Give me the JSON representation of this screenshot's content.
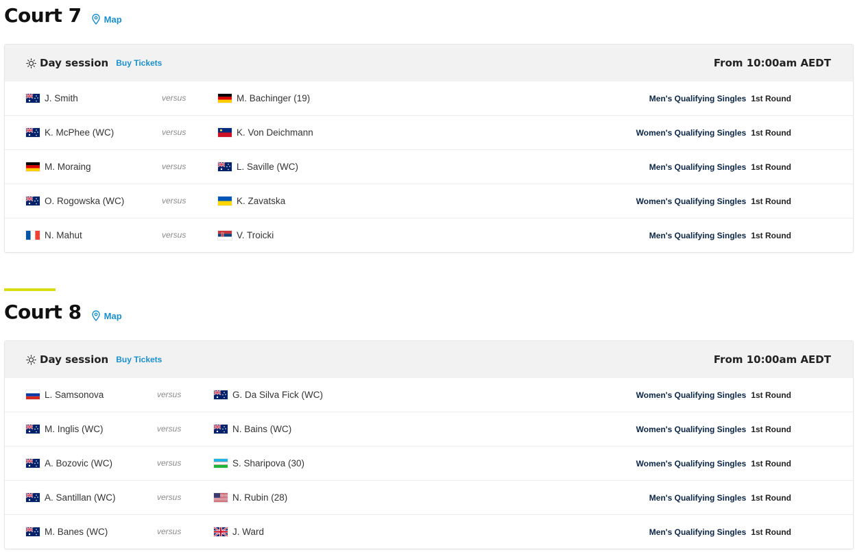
{
  "courts": [
    {
      "title": "Court 7",
      "map_label": "Map",
      "session": {
        "name": "Day session",
        "buy_label": "Buy Tickets",
        "time": "From 10:00am AEDT"
      },
      "matches": [
        {
          "p1": "J. Smith",
          "p1_flag": "AUS",
          "versus": "versus",
          "p2": "M. Bachinger (19)",
          "p2_flag": "GER",
          "event": "Men's Qualifying Singles",
          "round": "1st Round"
        },
        {
          "p1": "K. McPhee (WC)",
          "p1_flag": "AUS",
          "versus": "versus",
          "p2": "K. Von Deichmann",
          "p2_flag": "LIE",
          "event": "Women's Qualifying Singles",
          "round": "1st Round"
        },
        {
          "p1": "M. Moraing",
          "p1_flag": "GER",
          "versus": "versus",
          "p2": "L. Saville (WC)",
          "p2_flag": "AUS",
          "event": "Men's Qualifying Singles",
          "round": "1st Round"
        },
        {
          "p1": "O. Rogowska (WC)",
          "p1_flag": "AUS",
          "versus": "versus",
          "p2": "K. Zavatska",
          "p2_flag": "UKR",
          "event": "Women's Qualifying Singles",
          "round": "1st Round"
        },
        {
          "p1": "N. Mahut",
          "p1_flag": "FRA",
          "versus": "versus",
          "p2": "V. Troicki",
          "p2_flag": "SRB",
          "event": "Men's Qualifying Singles",
          "round": "1st Round"
        }
      ]
    },
    {
      "title": "Court 8",
      "map_label": "Map",
      "session": {
        "name": "Day session",
        "buy_label": "Buy Tickets",
        "time": "From 10:00am AEDT"
      },
      "matches": [
        {
          "p1": "L. Samsonova",
          "p1_flag": "RUS",
          "versus": "versus",
          "p2": "G. Da Silva Fick (WC)",
          "p2_flag": "AUS",
          "event": "Women's Qualifying Singles",
          "round": "1st Round"
        },
        {
          "p1": "M. Inglis (WC)",
          "p1_flag": "AUS",
          "versus": "versus",
          "p2": "N. Bains (WC)",
          "p2_flag": "AUS",
          "event": "Women's Qualifying Singles",
          "round": "1st Round"
        },
        {
          "p1": "A. Bozovic (WC)",
          "p1_flag": "AUS",
          "versus": "versus",
          "p2": "S. Sharipova (30)",
          "p2_flag": "UZB",
          "event": "Women's Qualifying Singles",
          "round": "1st Round"
        },
        {
          "p1": "A. Santillan (WC)",
          "p1_flag": "AUS",
          "versus": "versus",
          "p2": "N. Rubin (28)",
          "p2_flag": "USA",
          "event": "Men's Qualifying Singles",
          "round": "1st Round"
        },
        {
          "p1": "M. Banes (WC)",
          "p1_flag": "AUS",
          "versus": "versus",
          "p2": "J. Ward",
          "p2_flag": "GBR",
          "event": "Men's Qualifying Singles",
          "round": "1st Round"
        }
      ]
    }
  ],
  "colors": {
    "link": "#1a8fc9",
    "event_text": "#0b2545",
    "accent_bar": "#d7dd12",
    "session_bg": "#f2f2f2"
  }
}
